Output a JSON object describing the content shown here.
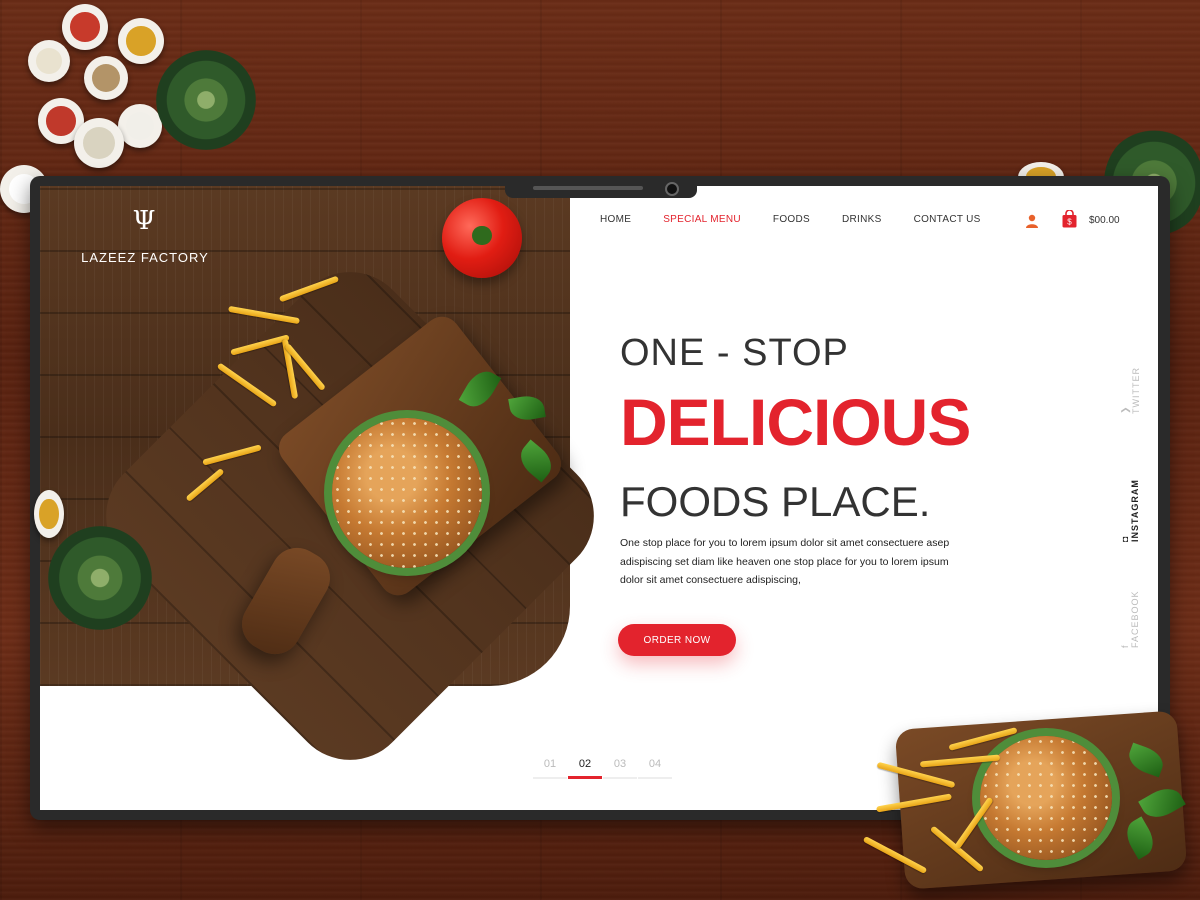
{
  "brand": {
    "name": "LAZEEZ FACTORY",
    "mark": "Ψ"
  },
  "nav": {
    "items": [
      {
        "label": "HOME",
        "active": false
      },
      {
        "label": "SPECIAL MENU",
        "active": true
      },
      {
        "label": "FOODS",
        "active": false
      },
      {
        "label": "DRINKS",
        "active": false
      },
      {
        "label": "CONTACT US",
        "active": false
      }
    ]
  },
  "header": {
    "cart_total": "$00.00",
    "user_icon": "user-icon",
    "cart_icon": "shopping-bag-icon"
  },
  "hero": {
    "line1": "ONE - STOP",
    "line2": "DELICIOUS",
    "line3": "FOODS PLACE.",
    "description": "One stop place for you to lorem ipsum dolor sit amet consectuere asep adispiscing set diam like heaven one stop place for you to lorem ipsum dolor sit amet consectuere adispiscing,",
    "cta": "ORDER NOW"
  },
  "social": {
    "items": [
      {
        "label": "TWITTER",
        "icon": "twitter-icon",
        "active": false
      },
      {
        "label": "INSTAGRAM",
        "icon": "instagram-icon",
        "active": true
      },
      {
        "label": "FACEBOOK",
        "icon": "facebook-icon",
        "active": false
      }
    ]
  },
  "pager": {
    "pages": [
      "01",
      "02",
      "03",
      "04"
    ],
    "current": "02"
  },
  "colors": {
    "accent": "#e3232d",
    "text": "#333333",
    "wood": "#5b3a22"
  }
}
